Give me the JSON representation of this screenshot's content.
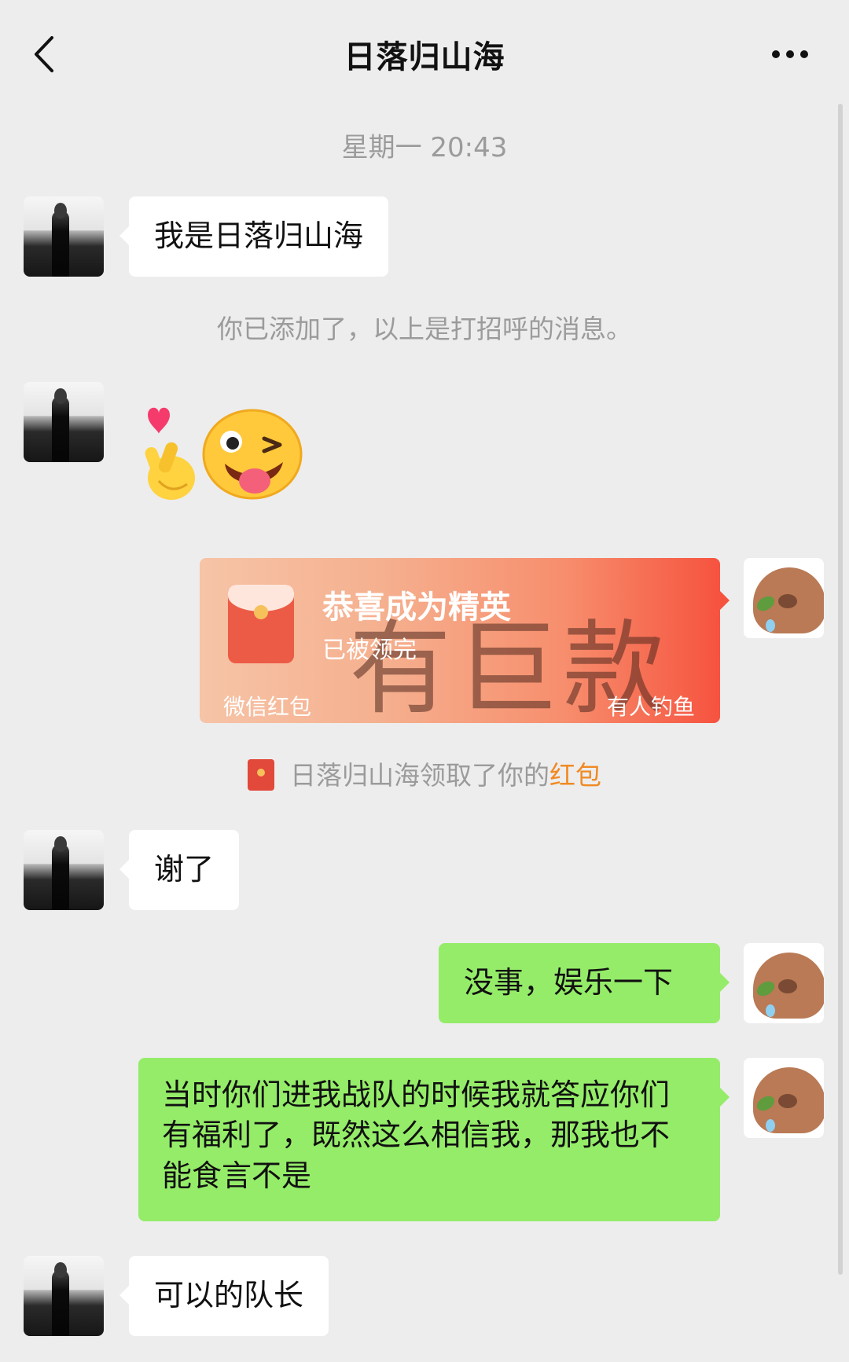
{
  "header": {
    "title": "日落归山海"
  },
  "timestamp": "星期一 20:43",
  "messages": {
    "greeting": "我是日落归山海",
    "system_notice": "你已添加了，以上是打招呼的消息。",
    "thanks": "谢了",
    "reply1": "没事，娱乐一下",
    "reply2": "当时你们进我战队的时候我就答应你们有福利了，既然这么相信我，那我也不能食言不是",
    "final": "可以的队长"
  },
  "red_envelope": {
    "title": "恭喜成为精英",
    "status": "已被领完",
    "footer_left": "微信红包",
    "footer_right": "有人钓鱼",
    "watermark": "有巨款"
  },
  "received_notice": {
    "prefix": "日落归山海领取了你的",
    "highlight": "红包"
  },
  "colors": {
    "background": "#ededed",
    "my_bubble": "#95ec69",
    "other_bubble": "#ffffff",
    "red_packet_highlight": "#f08a24"
  }
}
